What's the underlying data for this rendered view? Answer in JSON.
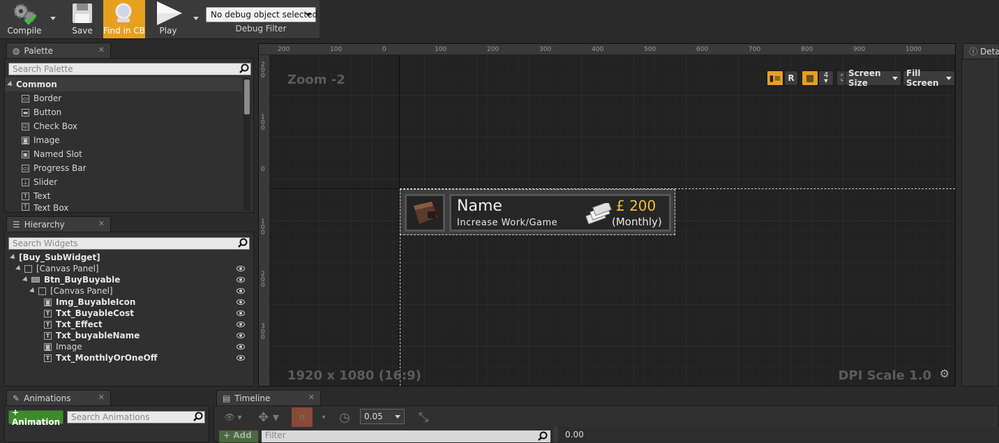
{
  "toolbar": {
    "compile_label": "Compile",
    "save_label": "Save",
    "find_label": "Find in CB",
    "play_label": "Play",
    "debug_object": "No debug object selected",
    "debug_filter_label": "Debug Filter"
  },
  "palette": {
    "tab_label": "Palette",
    "search_placeholder": "Search Palette",
    "category": "Common",
    "items": [
      {
        "label": "Border",
        "icon": "border-icon"
      },
      {
        "label": "Button",
        "icon": "button-icon"
      },
      {
        "label": "Check Box",
        "icon": "checkbox-icon"
      },
      {
        "label": "Image",
        "icon": "image-icon"
      },
      {
        "label": "Named Slot",
        "icon": "named-slot-icon"
      },
      {
        "label": "Progress Bar",
        "icon": "progress-bar-icon"
      },
      {
        "label": "Slider",
        "icon": "slider-icon"
      },
      {
        "label": "Text",
        "icon": "text-icon"
      },
      {
        "label": "Text Box",
        "icon": "text-box-icon"
      }
    ]
  },
  "hierarchy": {
    "tab_label": "Hierarchy",
    "search_placeholder": "Search Widgets",
    "items": [
      {
        "label": "[Buy_SubWidget]"
      },
      {
        "label": "[Canvas Panel]"
      },
      {
        "label": "Btn_BuyBuyable"
      },
      {
        "label": "[Canvas Panel]"
      },
      {
        "label": "Img_BuyableIcon"
      },
      {
        "label": "Txt_BuyableCost"
      },
      {
        "label": "Txt_Effect"
      },
      {
        "label": "Txt_buyableName"
      },
      {
        "label": "Image"
      },
      {
        "label": "Txt_MonthlyOrOneOff"
      }
    ]
  },
  "designer": {
    "zoom_label": "Zoom -2",
    "resolution_label": "1920 x 1080 (16:9)",
    "dpi_label": "DPI Scale 1.0",
    "ruler_top": [
      "200",
      "100",
      "0",
      "100",
      "200",
      "300",
      "400",
      "500",
      "600",
      "700",
      "800",
      "900",
      "1000"
    ],
    "ruler_left": [
      "2\n0\n0",
      "1\n0\n0",
      "0",
      "1\n0\n0",
      "2\n0\n0",
      "3\n0\n0"
    ],
    "toolbar": {
      "r_label": "R",
      "grid_snap_value": "4",
      "screen_size_label": "Screen Size",
      "fill_screen_label": "Fill Screen"
    },
    "widget": {
      "name": "Name",
      "effect": "Increase Work/Game",
      "cost": "£ 200",
      "period": "(Monthly)"
    }
  },
  "details": {
    "tab_label": "Deta"
  },
  "animations": {
    "tab_label": "Animations",
    "add_label": "+ Animation",
    "search_placeholder": "Search Animations"
  },
  "timeline": {
    "tab_label": "Timeline",
    "step_value": "0.05",
    "add_label": "+ Add",
    "filter_placeholder": "Filter",
    "time_value": "0.00"
  }
}
